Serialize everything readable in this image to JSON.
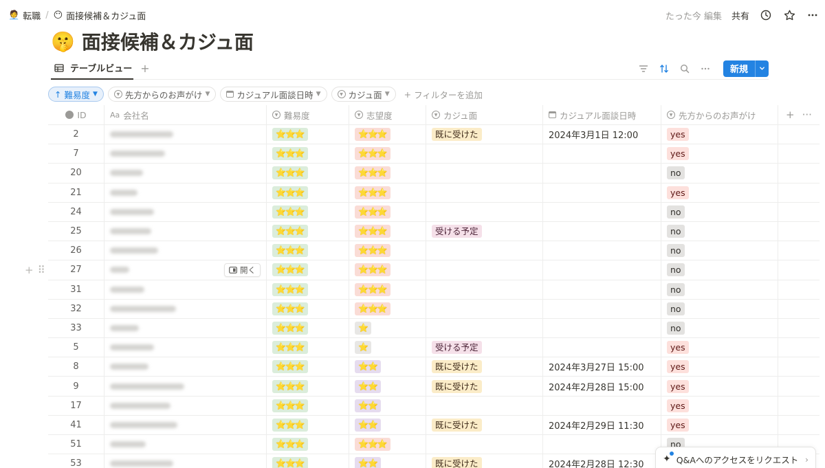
{
  "breadcrumb": [
    {
      "emoji": "🧑‍💼",
      "label": "転職"
    },
    {
      "emoji": "😶",
      "label": "面接候補＆カジュ面"
    }
  ],
  "topbar": {
    "edited": "たった今 編集",
    "share": "共有"
  },
  "page": {
    "emoji": "🤫",
    "title": "面接候補＆カジュ面"
  },
  "view": {
    "tab_label": "テーブルビュー",
    "new_label": "新規"
  },
  "filters": {
    "sort_chip": "難易度",
    "chips": [
      "先方からのお声がけ",
      "カジュアル面談日時",
      "カジュ面"
    ],
    "add_filter": "フィルターを追加"
  },
  "columns": {
    "id": "ID",
    "name": "会社名",
    "name_prefix": "Aa",
    "difficulty": "難易度",
    "desire": "志望度",
    "kaju": "カジュ面",
    "date": "カジュアル面談日時",
    "call": "先方からのお声がけ"
  },
  "open_label": "開く",
  "colors": {
    "accent": "#2383e2",
    "yes_bg": "#fde0dc",
    "no_bg": "#e3e2e0",
    "star": "#f2b515"
  },
  "rows": [
    {
      "id": "2",
      "difficulty": "⭐⭐⭐",
      "desire": "⭐⭐⭐",
      "desire_level": 3,
      "kaju": "既に受けた",
      "kaju_color": "yellow",
      "date": "2024年3月1日 12:00",
      "call": "yes"
    },
    {
      "id": "7",
      "difficulty": "⭐⭐⭐",
      "desire": "⭐⭐⭐",
      "desire_level": 3,
      "kaju": "",
      "kaju_color": "",
      "date": "",
      "call": "yes"
    },
    {
      "id": "20",
      "difficulty": "⭐⭐⭐",
      "desire": "⭐⭐⭐",
      "desire_level": 3,
      "kaju": "",
      "kaju_color": "",
      "date": "",
      "call": "no"
    },
    {
      "id": "21",
      "difficulty": "⭐⭐⭐",
      "desire": "⭐⭐⭐",
      "desire_level": 3,
      "kaju": "",
      "kaju_color": "",
      "date": "",
      "call": "yes"
    },
    {
      "id": "24",
      "difficulty": "⭐⭐⭐",
      "desire": "⭐⭐⭐",
      "desire_level": 3,
      "kaju": "",
      "kaju_color": "",
      "date": "",
      "call": "no"
    },
    {
      "id": "25",
      "difficulty": "⭐⭐⭐",
      "desire": "⭐⭐⭐",
      "desire_level": 3,
      "kaju": "受ける予定",
      "kaju_color": "pink",
      "date": "",
      "call": "no"
    },
    {
      "id": "26",
      "difficulty": "⭐⭐⭐",
      "desire": "⭐⭐⭐",
      "desire_level": 3,
      "kaju": "",
      "kaju_color": "",
      "date": "",
      "call": "no"
    },
    {
      "id": "27",
      "difficulty": "⭐⭐⭐",
      "desire": "⭐⭐⭐",
      "desire_level": 3,
      "kaju": "",
      "kaju_color": "",
      "date": "",
      "call": "no",
      "hover": true
    },
    {
      "id": "31",
      "difficulty": "⭐⭐⭐",
      "desire": "⭐⭐⭐",
      "desire_level": 3,
      "kaju": "",
      "kaju_color": "",
      "date": "",
      "call": "no"
    },
    {
      "id": "32",
      "difficulty": "⭐⭐⭐",
      "desire": "⭐⭐⭐",
      "desire_level": 3,
      "kaju": "",
      "kaju_color": "",
      "date": "",
      "call": "no"
    },
    {
      "id": "33",
      "difficulty": "⭐⭐⭐",
      "desire": "⭐",
      "desire_level": 1,
      "kaju": "",
      "kaju_color": "",
      "date": "",
      "call": "no"
    },
    {
      "id": "5",
      "difficulty": "⭐⭐⭐",
      "desire": "⭐",
      "desire_level": 1,
      "kaju": "受ける予定",
      "kaju_color": "pink",
      "date": "",
      "call": "yes"
    },
    {
      "id": "8",
      "difficulty": "⭐⭐⭐",
      "desire": "⭐⭐",
      "desire_level": 2,
      "kaju": "既に受けた",
      "kaju_color": "yellow",
      "date": "2024年3月27日 15:00",
      "call": "yes"
    },
    {
      "id": "9",
      "difficulty": "⭐⭐⭐",
      "desire": "⭐⭐",
      "desire_level": 2,
      "kaju": "既に受けた",
      "kaju_color": "yellow",
      "date": "2024年2月28日 15:00",
      "call": "yes"
    },
    {
      "id": "17",
      "difficulty": "⭐⭐⭐",
      "desire": "⭐⭐",
      "desire_level": 2,
      "kaju": "",
      "kaju_color": "",
      "date": "",
      "call": "yes"
    },
    {
      "id": "41",
      "difficulty": "⭐⭐⭐",
      "desire": "⭐⭐",
      "desire_level": 2,
      "kaju": "既に受けた",
      "kaju_color": "yellow",
      "date": "2024年2月29日 11:30",
      "call": "yes"
    },
    {
      "id": "51",
      "difficulty": "⭐⭐⭐",
      "desire": "⭐⭐⭐",
      "desire_level": 3,
      "kaju": "",
      "kaju_color": "",
      "date": "",
      "call": "no"
    },
    {
      "id": "53",
      "difficulty": "⭐⭐⭐",
      "desire": "⭐⭐",
      "desire_level": 2,
      "kaju": "既に受けた",
      "kaju_color": "yellow",
      "date": "2024年2月28日 12:30",
      "call": ""
    }
  ],
  "request_banner": "Q&Aへのアクセスをリクエスト"
}
